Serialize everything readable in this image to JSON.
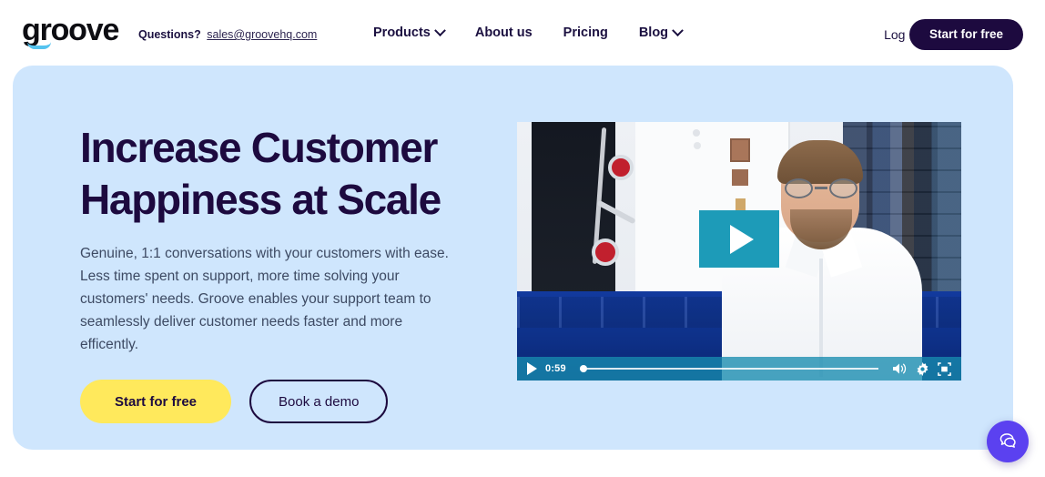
{
  "header": {
    "logo_text": "groove",
    "logo_icon": "groove-smile-swoosh",
    "questions_label": "Questions?",
    "email": "sales@groovehq.com",
    "nav": [
      {
        "label": "Products",
        "has_dropdown": true
      },
      {
        "label": "About us",
        "has_dropdown": false
      },
      {
        "label": "Pricing",
        "has_dropdown": false
      },
      {
        "label": "Blog",
        "has_dropdown": true
      }
    ],
    "login_label": "Log In",
    "cta_label": "Start for free"
  },
  "hero": {
    "headline_line1": "Increase Customer",
    "headline_line2": "Happiness at Scale",
    "subhead": "Genuine, 1:1 conversations with your customers with ease. Less time spent on support, more time solving your customers' needs. Groove enables your support team to seamlessly deliver customer needs faster and more efficently.",
    "primary_cta": "Start for free",
    "secondary_cta": "Book a demo",
    "background_color": "#cfe6fd"
  },
  "video": {
    "time_label": "0:59",
    "progress_percent": 0,
    "play_icon": "play-icon",
    "volume_icon": "volume-icon",
    "settings_icon": "gear-icon",
    "fullscreen_icon": "fullscreen-icon",
    "overlay_color": "#1d9bb8"
  },
  "chat_widget": {
    "icon": "chat-bubbles-icon",
    "color": "#5b41f0"
  },
  "colors": {
    "navy": "#1d0a3f",
    "yellow": "#ffe95c",
    "hero_blue": "#cfe6fd",
    "teal": "#1d9bb8",
    "purple": "#5b41f0"
  }
}
